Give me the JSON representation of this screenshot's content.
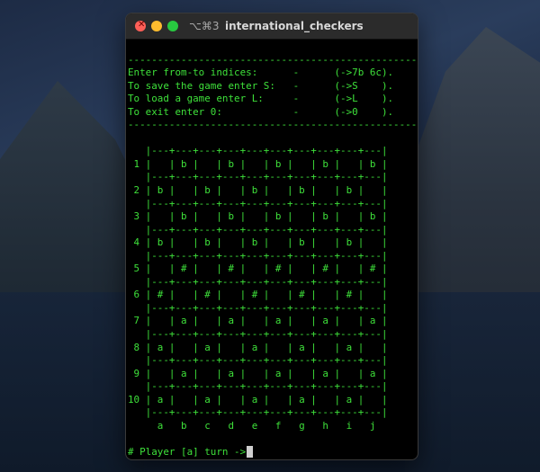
{
  "window": {
    "shortcut": "⌥⌘3",
    "title": "international_checkers"
  },
  "colors": {
    "terminal_fg": "#3ee03a",
    "close": "#ff5f57",
    "minimize": "#febc2e",
    "zoom": "#28c840"
  },
  "terminal": {
    "lines": [
      "",
      "----------------------------------------------------",
      "Enter from-to indices:      -      (->7b 6c).",
      "To save the game enter S:   -      (->S    ).",
      "To load a game enter L:     -      (->L    ).",
      "To exit enter 0:            -      (->0    ).",
      "----------------------------------------------------",
      "",
      "   |---+---+---+---+---+---+---+---+---+---|",
      " 1 |   | b |   | b |   | b |   | b |   | b |",
      "   |---+---+---+---+---+---+---+---+---+---|",
      " 2 | b |   | b |   | b |   | b |   | b |   |",
      "   |---+---+---+---+---+---+---+---+---+---|",
      " 3 |   | b |   | b |   | b |   | b |   | b |",
      "   |---+---+---+---+---+---+---+---+---+---|",
      " 4 | b |   | b |   | b |   | b |   | b |   |",
      "   |---+---+---+---+---+---+---+---+---+---|",
      " 5 |   | # |   | # |   | # |   | # |   | # |",
      "   |---+---+---+---+---+---+---+---+---+---|",
      " 6 | # |   | # |   | # |   | # |   | # |   |",
      "   |---+---+---+---+---+---+---+---+---+---|",
      " 7 |   | a |   | a |   | a |   | a |   | a |",
      "   |---+---+---+---+---+---+---+---+---+---|",
      " 8 | a |   | a |   | a |   | a |   | a |   |",
      "   |---+---+---+---+---+---+---+---+---+---|",
      " 9 |   | a |   | a |   | a |   | a |   | a |",
      "   |---+---+---+---+---+---+---+---+---+---|",
      "10 | a |   | a |   | a |   | a |   | a |   |",
      "   |---+---+---+---+---+---+---+---+---+---|",
      "     a   b   c   d   e   f   g   h   i   j"
    ],
    "prompt": "# Player [a] turn ->"
  }
}
